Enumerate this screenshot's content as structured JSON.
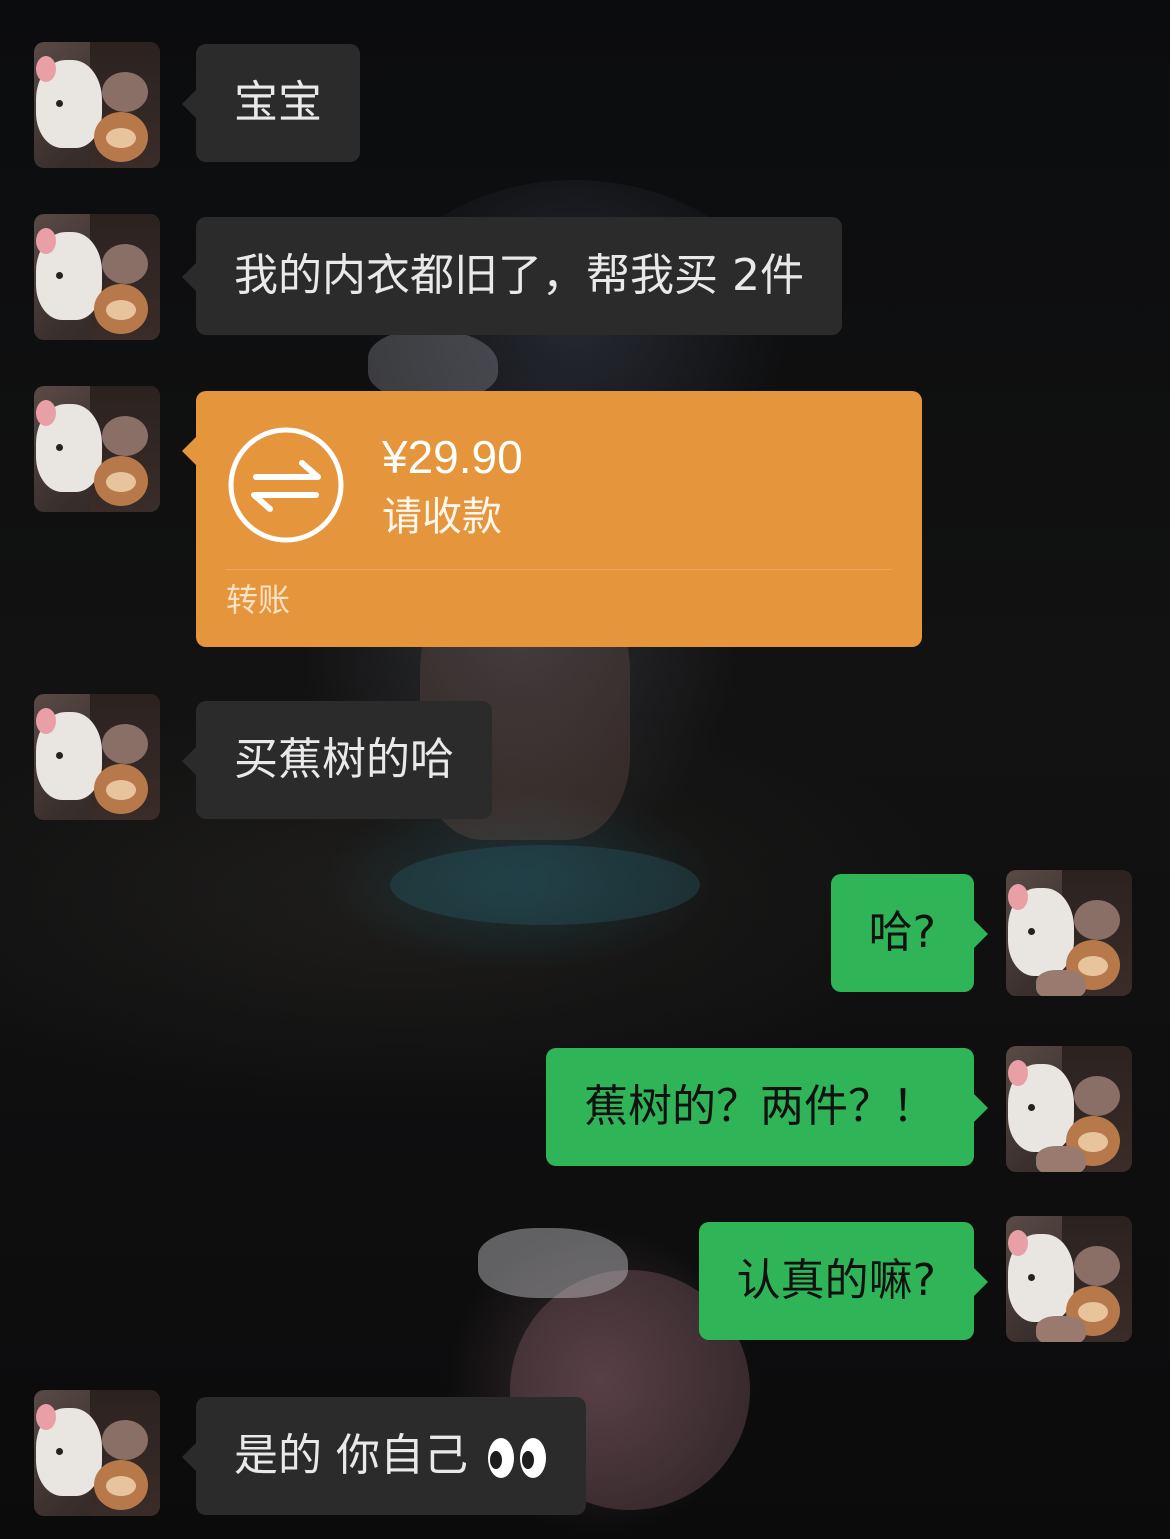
{
  "messages": [
    {
      "side": "in",
      "text": "宝宝"
    },
    {
      "side": "in",
      "text": "我的内衣都旧了，帮我买 2件"
    },
    {
      "side": "in",
      "type": "transfer",
      "amount": "¥29.90",
      "status": "请收款",
      "footer": "转账",
      "icon": "transfer-arrows-icon"
    },
    {
      "side": "in",
      "text": "买蕉树的哈"
    },
    {
      "side": "out",
      "text": "哈?"
    },
    {
      "side": "out",
      "text": "蕉树的？两件？！"
    },
    {
      "side": "out",
      "text": "认真的嘛?"
    },
    {
      "side": "in",
      "text": "是的 你自己",
      "emoji": "eyes-emoji"
    }
  ],
  "colors": {
    "incoming_bubble": "#2b2b2b",
    "outgoing_bubble": "#2fb457",
    "transfer_card": "#e5953b",
    "background": "#101011"
  }
}
